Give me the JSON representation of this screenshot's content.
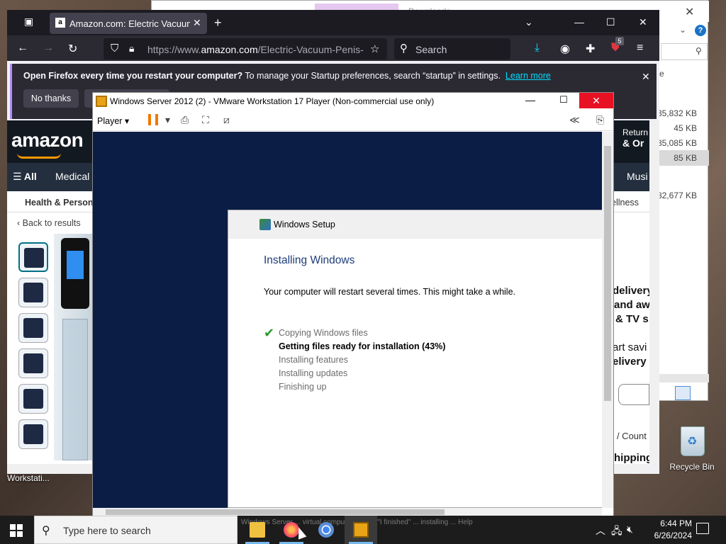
{
  "explorer": {
    "title_faded": "Downloads",
    "sizes": [
      "35,832 KB",
      "45 KB",
      "35,085 KB",
      "85 KB",
      "82,677 KB"
    ],
    "e_char": "e"
  },
  "firefox": {
    "tab_title": "Amazon.com: Electric Vacuum P",
    "tab_favicon": "a",
    "url_prefix": "https://www.",
    "url_domain": "amazon.com",
    "url_path": "/Electric-Vacuum-Penis-",
    "search_placeholder": "Search",
    "ext_badge": "5",
    "notice": {
      "bold": "Open Firefox every time you restart your computer?",
      "text": " To manage your Startup preferences, search “startup” in settings.",
      "link": "Learn more",
      "no_thanks": "No thanks"
    }
  },
  "amazon": {
    "logo": "amazon",
    "returns_line1": "Return",
    "returns_line2": "& Or",
    "all": "All",
    "medical": "Medical",
    "music": "Musi",
    "health": "Health & Persona",
    "wellness": "ellness",
    "back": "Back to results",
    "right_lines": [
      "delivery",
      "and aw",
      "& TV s",
      "art savi",
      "elivery"
    ],
    "right_count": "/ Count",
    "right_shipping": "hipping"
  },
  "vmware": {
    "title": "Windows Server 2012 (2) - VMware Workstation 17 Player (Non-commercial use only)",
    "player_menu": "Player",
    "setup": {
      "title": "Windows Setup",
      "heading": "Installing Windows",
      "message": "Your computer will restart several times. This might take a while.",
      "steps": [
        {
          "label": "Copying Windows files",
          "state": "done"
        },
        {
          "label": "Getting files ready for installation (43%)",
          "state": "active"
        },
        {
          "label": "Installing features",
          "state": "pending"
        },
        {
          "label": "Installing updates",
          "state": "pending"
        },
        {
          "label": "Finishing up",
          "state": "pending"
        }
      ],
      "progress_percent": 43
    }
  },
  "desktop": {
    "recycle_bin": "Recycle Bin",
    "workstation_label": "Workstati..."
  },
  "taskbar": {
    "search_placeholder": "Type here to search",
    "time": "6:44 PM",
    "date": "6/26/2024",
    "ghost_text": "Windows Server ... virtual computer ... disk \"I finished\" ... installing ... Help",
    "apps": [
      "file-explorer-icon",
      "firefox-icon",
      "chrome-icon",
      "vmware-icon"
    ]
  }
}
